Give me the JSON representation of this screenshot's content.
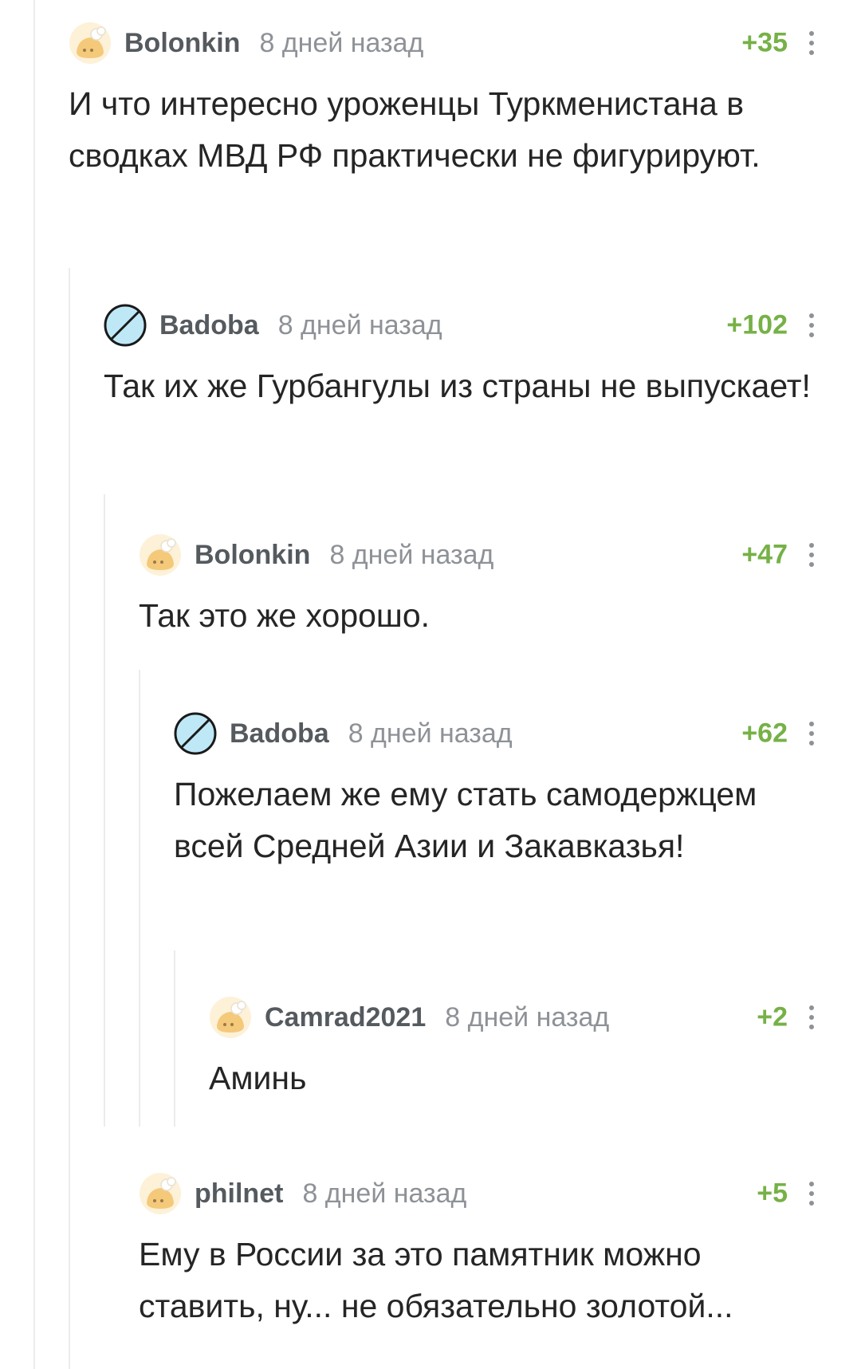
{
  "comments": [
    {
      "username": "Bolonkin",
      "time": "8 дней назад",
      "rating": "+35",
      "avatar": "default-avatar-icon",
      "text": "И что интересно уроженцы Туркменистана в сводках МВД РФ практически не фигурируют."
    },
    {
      "username": "Badoba",
      "time": "8 дней назад",
      "rating": "+102",
      "avatar": "prohibited-sign-avatar-icon",
      "text": "Так их же Гурбангулы из страны не выпускает!"
    },
    {
      "username": "Bolonkin",
      "time": "8 дней назад",
      "rating": "+47",
      "avatar": "default-avatar-icon",
      "text": "Так это же хорошо."
    },
    {
      "username": "Badoba",
      "time": "8 дней назад",
      "rating": "+62",
      "avatar": "prohibited-sign-avatar-icon",
      "text": "Пожелаем же ему стать самодержцем всей Средней Азии и Закавказья!"
    },
    {
      "username": "Camrad2021",
      "time": "8 дней назад",
      "rating": "+2",
      "avatar": "default-avatar-icon",
      "text": "Аминь"
    },
    {
      "username": "philnet",
      "time": "8 дней назад",
      "rating": "+5",
      "avatar": "default-avatar-icon",
      "text": "Ему в России за это памятник можно ставить, ну... не обязательно золотой..."
    }
  ],
  "colors": {
    "rating": "#76b147",
    "username": "#555a5f",
    "time": "#8e9297",
    "text": "#252525",
    "thread_line": "#ececec"
  }
}
